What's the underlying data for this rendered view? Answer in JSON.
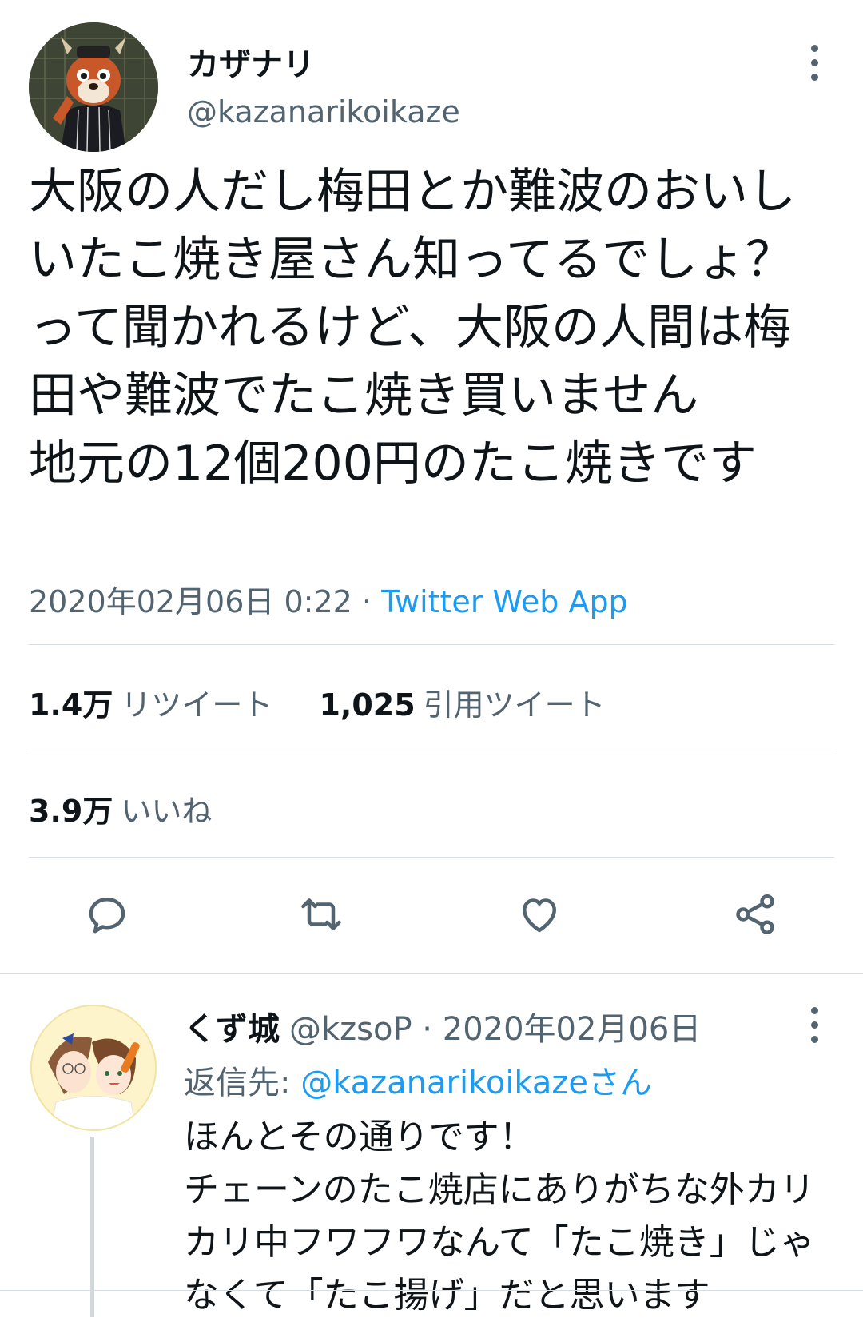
{
  "tweet": {
    "author_name": "カザナリ",
    "author_handle": "@kazanarikoikaze",
    "text": "大阪の人だし梅田とか難波のおいしいたこ焼き屋さん知ってるでしょ？って聞かれるけど、大阪の人間は梅田や難波でたこ焼き買いません\n地元の12個200円のたこ焼きです",
    "datetime": "2020年02月06日 0:22",
    "separator": " · ",
    "via": "Twitter Web App"
  },
  "stats": {
    "retweets_count": "1.4万",
    "retweets_label": "リツイート",
    "quotes_count": "1,025",
    "quotes_label": "引用ツイート",
    "likes_count": "3.9万",
    "likes_label": "いいね"
  },
  "actions": [
    "reply-icon",
    "retweet-icon",
    "like-icon",
    "share-icon"
  ],
  "reply": {
    "author_name": "くず城",
    "author_handle": "@kzsoP",
    "separator": " · ",
    "date": "2020年02月06日",
    "reply_prefix": "返信先: ",
    "reply_mention": "@kazanarikoikazeさん",
    "text": "ほんとその通りです！\nチェーンのたこ焼店にありがちな外カリカリ中フワフワなんて「たこ焼き」じゃなくて「たこ揚げ」だと思います"
  },
  "colors": {
    "text": "#0f1419",
    "secondary": "#536471",
    "accent": "#1d9bf0",
    "divider": "#d7dde1"
  }
}
